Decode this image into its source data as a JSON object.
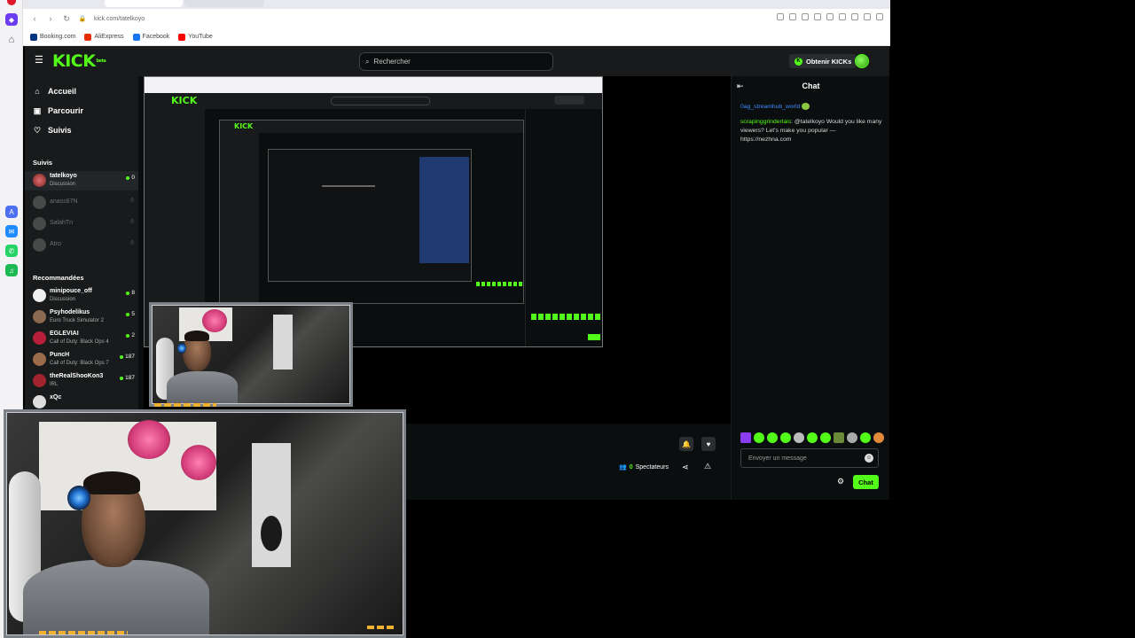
{
  "browser": {
    "url": "kick.com/tatelkoyo",
    "bookmarks": [
      {
        "label": "Booking.com",
        "color": "#003580"
      },
      {
        "label": "AliExpress",
        "color": "#e62e04"
      },
      {
        "label": "Facebook",
        "color": "#1877f2"
      },
      {
        "label": "YouTube",
        "color": "#ff0000"
      }
    ]
  },
  "header": {
    "logo": "KICK",
    "logo_sup": "beta",
    "search_placeholder": "Rechercher",
    "get_kicks": "Obtenir KICKs"
  },
  "nav": {
    "home": "Accueil",
    "browse": "Parcourir",
    "following": "Suivis"
  },
  "sidebar": {
    "following_title": "Suivis",
    "following": [
      {
        "name": "tatelkoyo",
        "category": "Discussion",
        "viewers": "0",
        "live": true,
        "color": "#c0392b"
      },
      {
        "name": "anass87N",
        "category": "",
        "viewers": "",
        "live": false,
        "color": "#777"
      },
      {
        "name": "SalahTn",
        "category": "",
        "viewers": "",
        "live": false,
        "color": "#777"
      },
      {
        "name": "Atro",
        "category": "",
        "viewers": "",
        "live": false,
        "color": "#777"
      }
    ],
    "recommended_title": "Recommandées",
    "recommended": [
      {
        "name": "minipouce_off",
        "category": "Discussion",
        "viewers": "8",
        "color": "#eeeeee"
      },
      {
        "name": "Psyhodelikus",
        "category": "Euro Truck Simulator 2",
        "viewers": "5",
        "color": "#8a6a50"
      },
      {
        "name": "EGLEVIAI",
        "category": "Call of Duty: Black Ops 4",
        "viewers": "2",
        "color": "#b8203a"
      },
      {
        "name": "PuncH",
        "category": "Call of Duty: Black Ops 7",
        "viewers": "187",
        "color": "#9c6b4a"
      },
      {
        "name": "theRealShooKon3",
        "category": "IRL",
        "viewers": "187",
        "color": "#a0232d"
      },
      {
        "name": "xQc",
        "category": "",
        "viewers": "",
        "color": "#dddddd"
      }
    ]
  },
  "stream": {
    "viewers_count": "0",
    "viewers_label": "Spectateurs"
  },
  "chat": {
    "title": "Chat",
    "messages": [
      {
        "user": "0ag_streamhub_world",
        "text": "",
        "user_color": "#3e8cff"
      },
      {
        "user": "scrapinggrinderlais",
        "text": ": @tatelkoyo Would you like many viewers? Let's make you popular — https://nezhna.com",
        "user_color": "#53fc18"
      }
    ],
    "input_placeholder": "Envoyer un message",
    "send_label": "Chat"
  }
}
